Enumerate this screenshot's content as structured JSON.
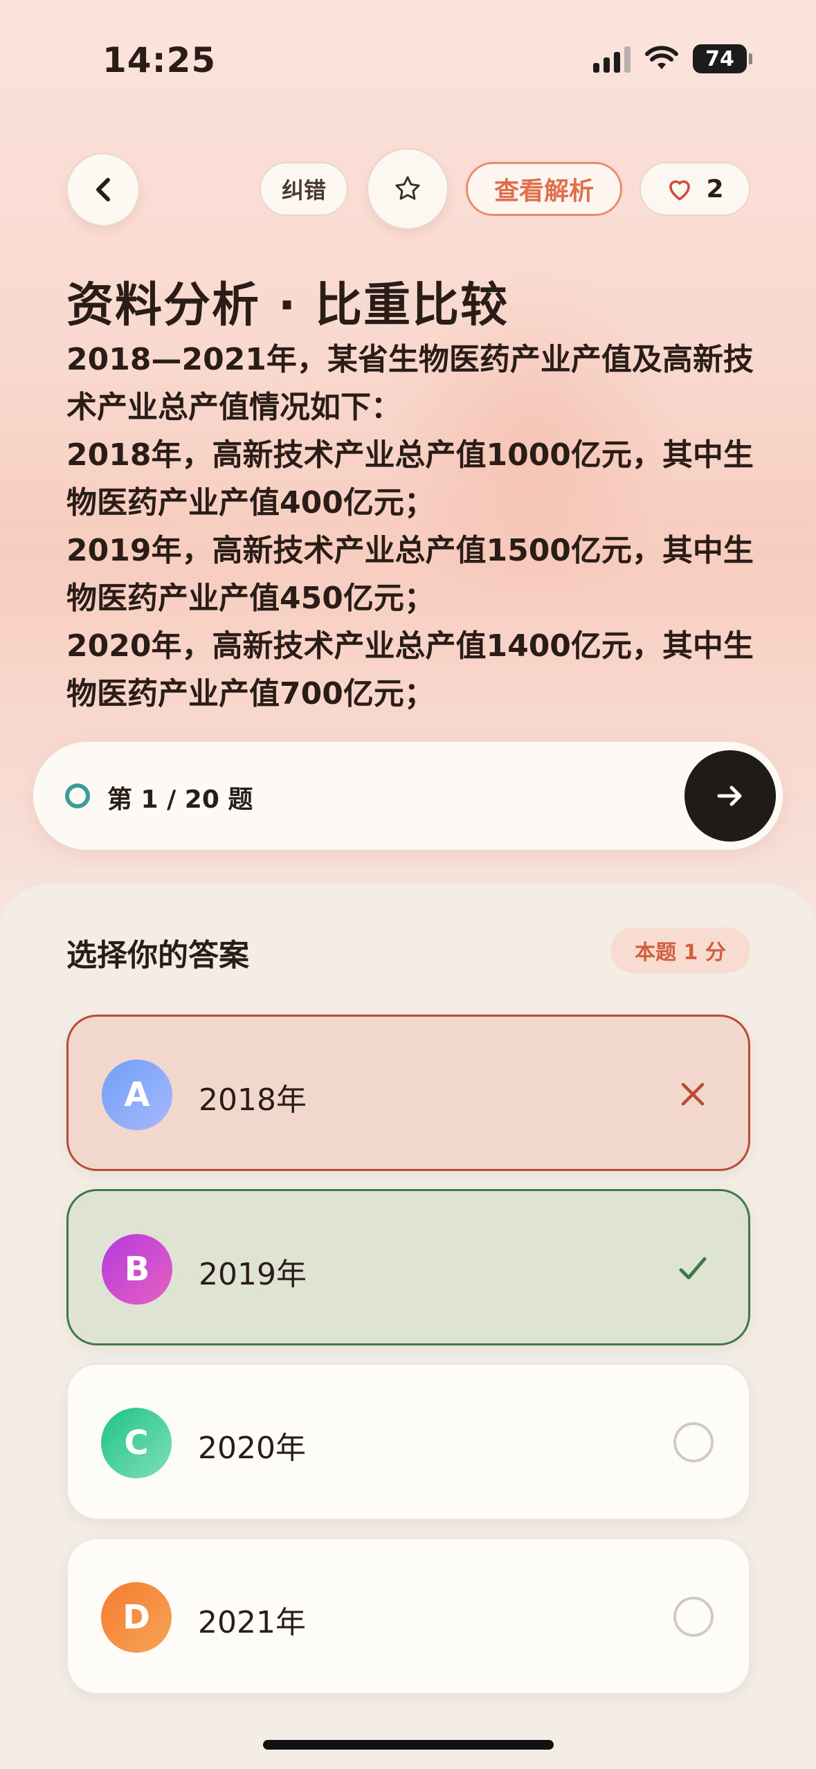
{
  "status_bar": {
    "time": "14:25",
    "battery": "74"
  },
  "header": {
    "correct_label": "纠错",
    "analysis_label": "查看解析",
    "like_count": "2",
    "icons": [
      "back-chevron-icon",
      "star-icon",
      "heart-icon"
    ]
  },
  "question": {
    "title": "资料分析 · 比重比较",
    "passage": [
      "2018—2021年，某省生物医药产业产值及高新技术产业总产值情况如下：",
      "2018年，高新技术产业总产值1000亿元，其中生物医药产业产值400亿元；",
      "2019年，高新技术产业总产值1500亿元，其中生物医药产业产值450亿元；",
      "2020年，高新技术产业总产值1400亿元，其中生物医药产业产值700亿元；"
    ]
  },
  "progress": {
    "label": "第 1 / 20 题"
  },
  "answer_sheet": {
    "title": "选择你的答案",
    "score": "本题 1 分",
    "options": [
      {
        "letter": "A",
        "text": "2018年",
        "state": "wrong",
        "color_from": "#6fa0f6",
        "color_to": "#a8b8fb"
      },
      {
        "letter": "B",
        "text": "2019年",
        "state": "correct",
        "color_from": "#b53be0",
        "color_to": "#e660bf"
      },
      {
        "letter": "C",
        "text": "2020年",
        "state": "unselected",
        "color_from": "#1fc287",
        "color_to": "#7fe0b8"
      },
      {
        "letter": "D",
        "text": "2021年",
        "state": "unselected",
        "color_from": "#f57a2f",
        "color_to": "#f7a657"
      }
    ]
  },
  "colors": {
    "accent": "#e0704d",
    "wrong": "#b94a36",
    "correct": "#3c7a43",
    "progress_ring": "#3d9c93"
  }
}
